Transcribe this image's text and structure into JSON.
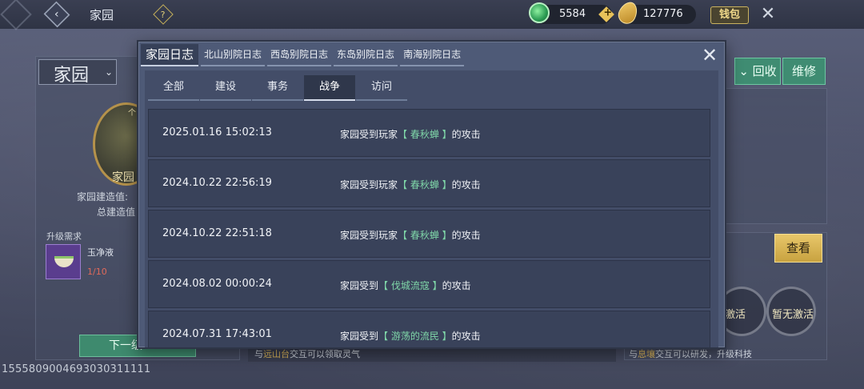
{
  "topbar": {
    "title": "家园",
    "jade_amount": "5584",
    "seed_amount": "127776",
    "wallet_label": "钱包"
  },
  "left": {
    "home_select": "家园",
    "emblem_small": "个",
    "emblem_label": "家园",
    "build_value_label": "家园建造值:",
    "total_build_label": "总建造值",
    "upgrade_need_label": "升级需求",
    "item_name": "玉净液",
    "item_count": "1/10",
    "next_button": "下一级"
  },
  "right": {
    "recycle_label": "回收",
    "repair_label": "维修",
    "view_label": "查看",
    "inactive_1": "激活",
    "inactive_2": "暂无激活",
    "hint_prefix": "与",
    "hint_place": "息壤",
    "hint_suffix": "交互可以研发，升级科技"
  },
  "middle_hint": {
    "prefix": "与",
    "place": "远山台",
    "suffix": "交互可以领取灵气"
  },
  "footer_id": "1555809004693030311111",
  "dialog": {
    "tabs": [
      {
        "label": "家园日志",
        "active": true
      },
      {
        "label": "北山别院日志",
        "active": false
      },
      {
        "label": "西岛别院日志",
        "active": false
      },
      {
        "label": "东岛别院日志",
        "active": false
      },
      {
        "label": "南海别院日志",
        "active": false
      }
    ],
    "sub_tabs": [
      {
        "label": "全部",
        "active": false
      },
      {
        "label": "建设",
        "active": false
      },
      {
        "label": "事务",
        "active": false
      },
      {
        "label": "战争",
        "active": true
      },
      {
        "label": "访问",
        "active": false
      }
    ],
    "logs": [
      {
        "date": "2025.01.16 15:02:13",
        "prefix": "家园受到玩家",
        "name": "【 春秋蝉 】",
        "suffix": "的攻击"
      },
      {
        "date": "2024.10.22 22:56:19",
        "prefix": "家园受到玩家",
        "name": "【 春秋蝉 】",
        "suffix": "的攻击"
      },
      {
        "date": "2024.10.22 22:51:18",
        "prefix": "家园受到玩家",
        "name": "【 春秋蝉 】",
        "suffix": "的攻击"
      },
      {
        "date": "2024.08.02 00:00:24",
        "prefix": "家园受到",
        "name": "【 伐城流寇 】",
        "suffix": "的攻击"
      },
      {
        "date": "2024.07.31 17:43:01",
        "prefix": "家园受到",
        "name": "【 游荡的流民 】",
        "suffix": "的攻击"
      }
    ]
  }
}
